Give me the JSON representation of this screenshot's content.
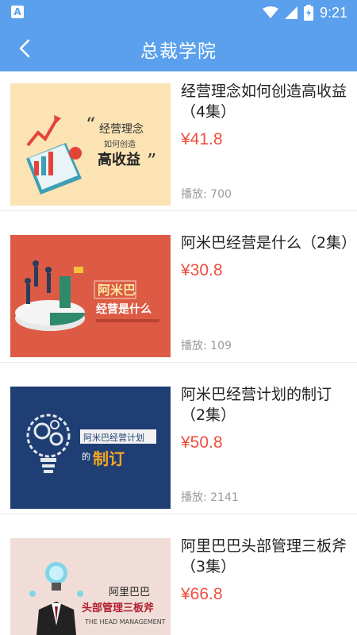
{
  "status_bar": {
    "time": "9:21",
    "notification_letter": "A"
  },
  "header": {
    "title": "总裁学院"
  },
  "courses": [
    {
      "title": "经营理念如何创造高收益（4集）",
      "price": "¥41.8",
      "plays_label": "播放: ",
      "plays_count": "700",
      "thumb_texts": [
        "经营理念",
        "如何创造",
        "高收益"
      ]
    },
    {
      "title": "阿米巴经营是什么（2集）",
      "price": "¥30.8",
      "plays_label": "播放: ",
      "plays_count": "109",
      "thumb_texts": [
        "阿米巴",
        "经营是什么"
      ]
    },
    {
      "title": "阿米巴经营计划的制订（2集）",
      "price": "¥50.8",
      "plays_label": "播放: ",
      "plays_count": "2141",
      "thumb_texts": [
        "阿米巴经营计划",
        "的",
        "制订"
      ]
    },
    {
      "title": "阿里巴巴头部管理三板斧（3集）",
      "price": "¥66.8",
      "plays_label": "",
      "plays_count": "",
      "thumb_texts": [
        "阿里巴巴",
        "头部管理三板斧",
        "THE HEAD MANAGEMENT"
      ]
    }
  ],
  "colors": {
    "accent": "#5aa0ec",
    "price": "#ee4f3f"
  }
}
